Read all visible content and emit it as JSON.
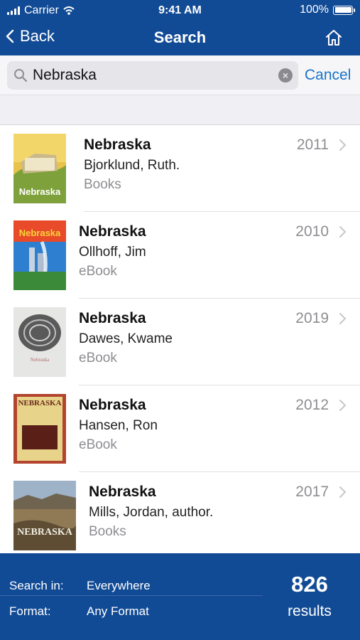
{
  "status_bar": {
    "carrier": "Carrier",
    "time": "9:41 AM",
    "battery": "100%"
  },
  "nav": {
    "back_label": "Back",
    "title": "Search",
    "home_icon": "home-icon"
  },
  "search": {
    "value": "Nebraska",
    "cancel_label": "Cancel"
  },
  "results": [
    {
      "title": "Nebraska",
      "author": "Bjorklund, Ruth.",
      "format": "Books",
      "year": "2011",
      "cover_title": "Nebraska"
    },
    {
      "title": "Nebraska",
      "author": "Ollhoff, Jim",
      "format": "eBook",
      "year": "2010",
      "cover_title": "Nebraska"
    },
    {
      "title": "Nebraska",
      "author": "Dawes, Kwame",
      "format": "eBook",
      "year": "2019",
      "cover_title": "Nebraska"
    },
    {
      "title": "Nebraska",
      "author": "Hansen, Ron",
      "format": "eBook",
      "year": "2012",
      "cover_title": "NEBRASKA"
    },
    {
      "title": "Nebraska",
      "author": "Mills, Jordan, author.",
      "format": "Books",
      "year": "2017",
      "cover_title": "NEBRASKA"
    }
  ],
  "footer": {
    "search_in_label": "Search in:",
    "search_in_value": "Everywhere",
    "format_label": "Format:",
    "format_value": "Any Format",
    "count": "826",
    "results_label": "results"
  },
  "colors": {
    "brand_blue": "#124b95",
    "link_blue": "#1a73c8",
    "secondary_text": "#8e8e93"
  }
}
